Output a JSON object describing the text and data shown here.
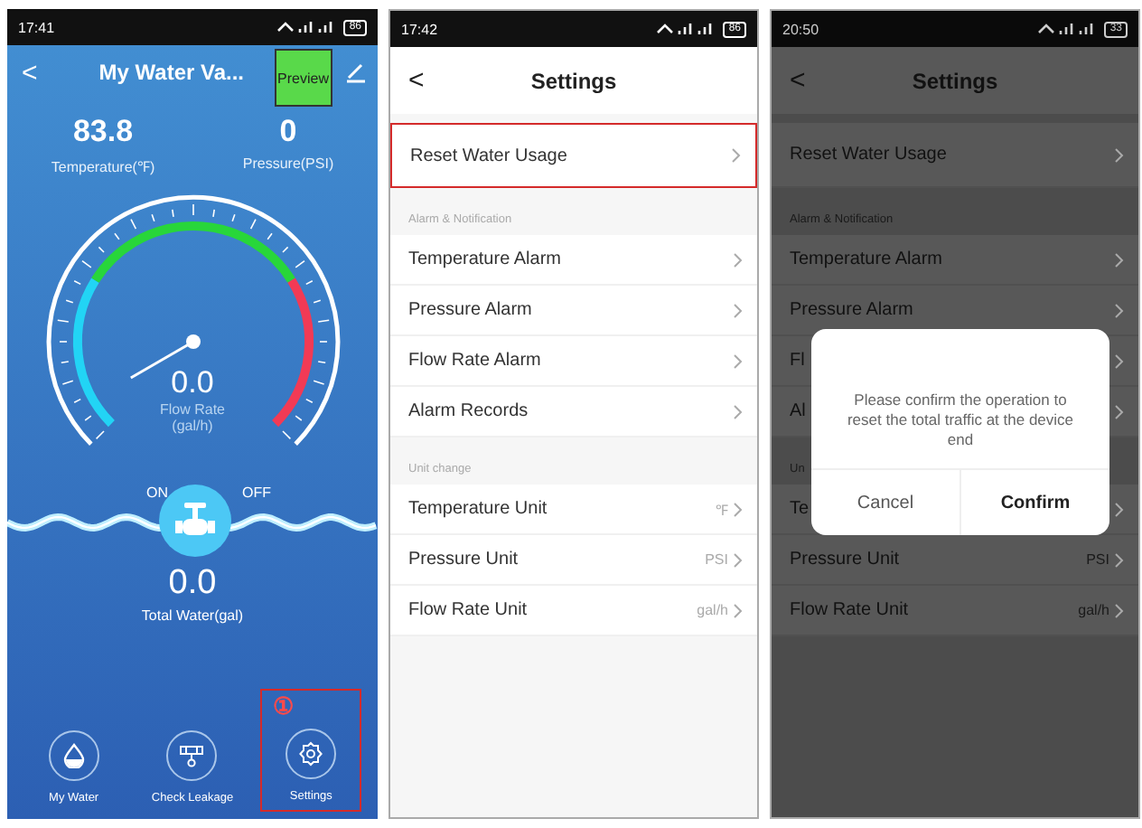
{
  "panels": [
    {
      "kind": "device",
      "status": {
        "time": "17:41",
        "battery": "86"
      },
      "header": {
        "back": "<",
        "title": "My Water Va...",
        "preview": "Preview"
      },
      "readings": [
        {
          "value": "83.8",
          "label": "Temperature(℉)"
        },
        {
          "value": "0",
          "label": "Pressure(PSI)"
        }
      ],
      "flow": {
        "value": "0.0",
        "label": "Flow Rate",
        "unit": "(gal/h)"
      },
      "valve": {
        "on_label": "ON",
        "off_label": "OFF"
      },
      "total": {
        "value": "0.0",
        "label": "Total Water(gal)"
      },
      "nav": [
        {
          "kind": "drop",
          "label": "My Water",
          "annotated": false
        },
        {
          "kind": "leak",
          "label": "Check Leakage",
          "annotated": false
        },
        {
          "kind": "gear",
          "label": "Settings",
          "annotated": true,
          "marker": "①"
        }
      ]
    },
    {
      "kind": "settings",
      "status": {
        "time": "17:42",
        "battery": "86"
      },
      "header": {
        "back": "<",
        "title": "Settings"
      },
      "items": [
        {
          "kind": "row",
          "label": "Reset Water Usage",
          "highlighted": true
        },
        {
          "kind": "section",
          "label": "Alarm & Notification"
        },
        {
          "kind": "row",
          "label": "Temperature Alarm",
          "highlighted": false
        },
        {
          "kind": "row",
          "label": "Pressure Alarm",
          "highlighted": false
        },
        {
          "kind": "row",
          "label": "Flow Rate Alarm",
          "highlighted": false
        },
        {
          "kind": "row",
          "label": "Alarm Records",
          "highlighted": false
        },
        {
          "kind": "section",
          "label": "Unit change"
        },
        {
          "kind": "row",
          "label": "Temperature Unit",
          "value": "℉",
          "highlighted": false
        },
        {
          "kind": "row",
          "label": "Pressure Unit",
          "value": "PSI",
          "highlighted": false
        },
        {
          "kind": "row",
          "label": "Flow Rate Unit",
          "value": "gal/h",
          "highlighted": false
        }
      ]
    },
    {
      "kind": "settings",
      "status": {
        "time": "20:50",
        "battery": "33"
      },
      "header": {
        "back": "<",
        "title": "Settings"
      },
      "items": [
        {
          "kind": "row",
          "label": "Reset Water Usage",
          "highlighted": false
        },
        {
          "kind": "section",
          "label": "Alarm & Notification"
        },
        {
          "kind": "row",
          "label": "Temperature Alarm",
          "highlighted": false
        },
        {
          "kind": "row",
          "label": "Pressure Alarm",
          "highlighted": false
        },
        {
          "kind": "row",
          "label": "Fl",
          "highlighted": false
        },
        {
          "kind": "row",
          "label": "Al",
          "highlighted": false
        },
        {
          "kind": "section",
          "label": "Un"
        },
        {
          "kind": "row",
          "label": "Te",
          "highlighted": false
        },
        {
          "kind": "row",
          "label": "Pressure Unit",
          "value": "PSI",
          "highlighted": false
        },
        {
          "kind": "row",
          "label": "Flow Rate Unit",
          "value": "gal/h",
          "highlighted": false
        }
      ],
      "dialog": {
        "message": "Please confirm the operation to reset the total traffic at the device end",
        "buttons": [
          {
            "label": "Cancel",
            "primary": false
          },
          {
            "label": "Confirm",
            "primary": true
          }
        ]
      }
    }
  ]
}
